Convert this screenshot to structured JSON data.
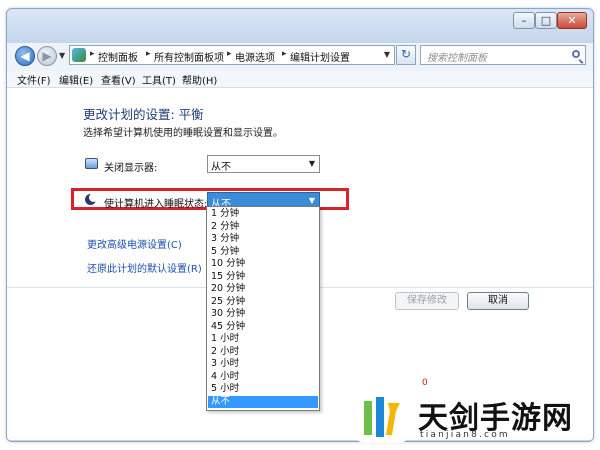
{
  "window": {
    "caption_buttons": {
      "minimize": "–",
      "maximize": "□",
      "close": "✕"
    }
  },
  "nav": {
    "back_glyph": "◀",
    "forward_glyph": "▶",
    "history_glyph": "▼",
    "breadcrumbs": [
      "控制面板",
      "所有控制面板项",
      "电源选项",
      "编辑计划设置"
    ],
    "separator": "▸",
    "refresh_glyph": "↻",
    "search_placeholder": "搜索控制面板"
  },
  "menu": [
    "文件(F)",
    "编辑(E)",
    "查看(V)",
    "工具(T)",
    "帮助(H)"
  ],
  "content": {
    "title": "更改计划的设置: 平衡",
    "subtitle": "选择希望计算机使用的睡眠设置和显示设置。",
    "display_label": "关闭显示器:",
    "display_value": "从不",
    "sleep_label": "使计算机进入睡眠状态:",
    "sleep_value": "从不",
    "link_advanced": "更改高级电源设置(C)",
    "link_restore": "还原此计划的默认设置(R)",
    "save_label": "保存修改",
    "cancel_label": "取消",
    "arrow": "▼"
  },
  "dropdown": {
    "options": [
      "1 分钟",
      "2 分钟",
      "3 分钟",
      "5 分钟",
      "10 分钟",
      "15 分钟",
      "20 分钟",
      "25 分钟",
      "30 分钟",
      "45 分钟",
      "1 小时",
      "2 小时",
      "3 小时",
      "4 小时",
      "5 小时",
      "从不"
    ],
    "selected": "从不"
  },
  "watermark": {
    "name": "天剑手游网",
    "url": "tianjian8.com",
    "mark": "0"
  },
  "colors": {
    "highlight": "#d9232a",
    "selection": "#3399ff",
    "link": "#1d4fb0"
  }
}
